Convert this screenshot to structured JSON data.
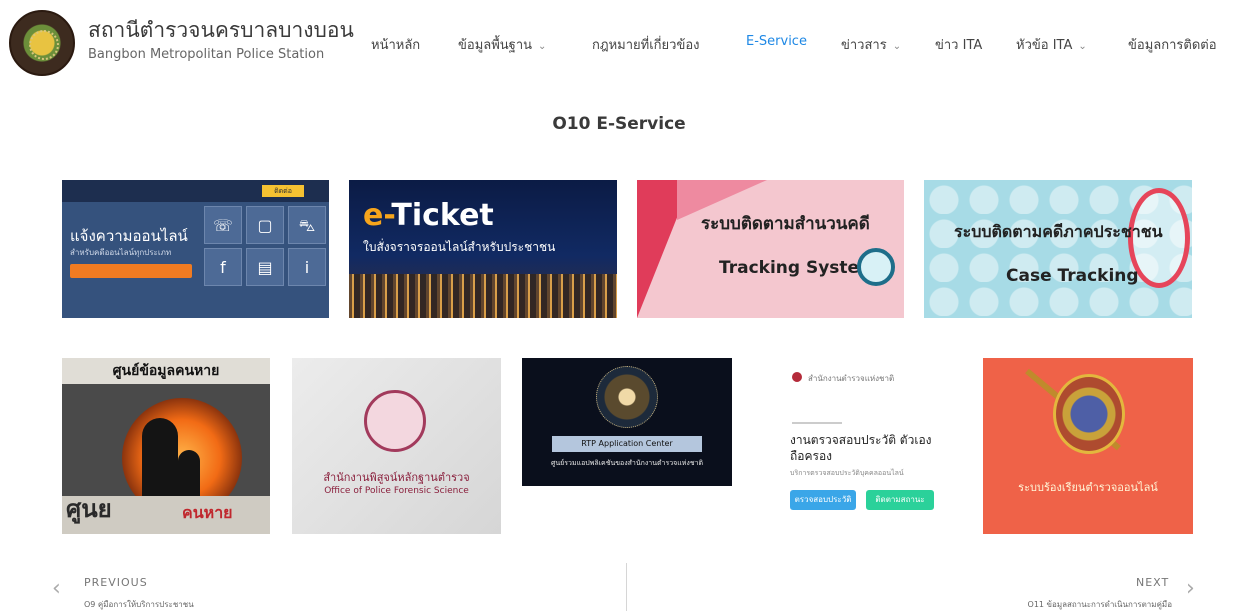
{
  "brand": {
    "title": "สถานีตำรวจนครบาลบางบอน",
    "subtitle": "Bangbon Metropolitan Police Station"
  },
  "nav": {
    "items": [
      {
        "label": "หน้าหลัก",
        "dropdown": false
      },
      {
        "label": "ข้อมูลพื้นฐาน",
        "dropdown": true
      },
      {
        "label": "กฎหมายที่เกี่ยวข้อง",
        "dropdown": false
      },
      {
        "label": "E-Service",
        "dropdown": false,
        "active": true
      },
      {
        "label": "ข่าวสาร",
        "dropdown": true
      },
      {
        "label": "ข่าว ITA",
        "dropdown": false
      },
      {
        "label": "หัวข้อ ITA",
        "dropdown": true
      },
      {
        "label": "ข้อมูลการติดต่อ",
        "dropdown": false
      }
    ],
    "caret": "⌄",
    "active_color": "#1e88e5"
  },
  "page": {
    "title": "O10 E-Service"
  },
  "cards": {
    "online_report": {
      "headline": "แจ้งความออนไลน์",
      "sub": "สำหรับคดีออนไลน์ทุกประเภท",
      "badge": "ติดต่อ",
      "icons": [
        "phone-icon",
        "chat-icon",
        "car-icon",
        "facebook-icon",
        "document-icon",
        "info-icon"
      ],
      "accent": "#f07b21"
    },
    "eticket": {
      "e": "e-",
      "word": "Ticket",
      "sub": "ใบสั่งจราจรออนไลน์สำหรับประชาชน"
    },
    "tracking": {
      "th": "ระบบติดตามสำนวนคดี",
      "en": "Tracking System"
    },
    "case_tracking": {
      "th": "ระบบติดตามคดีภาคประชาชน",
      "en": "Case Tracking"
    },
    "missing": {
      "header": "ศูนย์ข้อมูลคนหาย",
      "foot_a": "ศูนย",
      "foot_b": "คนหาย"
    },
    "forensic": {
      "th": "สำนักงานพิสูจน์หลักฐานตำรวจ",
      "en": "Office of Police Forensic Science"
    },
    "rtp": {
      "caption": "RTP Application Center",
      "sub": "ศูนย์รวมแอปพลิเคชันของสำนักงานตำรวจแห่งชาติ"
    },
    "background_check": {
      "brand": "สำนักงานตำรวจแห่งชาติ",
      "title": "งานตรวจสอบประวัติ ตัวเอง ถือครอง",
      "sub": "บริการตรวจสอบประวัติบุคคลออนไลน์",
      "btn1": "ตรวจสอบประวัติ",
      "btn2": "ติดตามสถานะ"
    },
    "complaint": {
      "caption": "ระบบร้องเรียนตำรวจออนไลน์"
    }
  },
  "footer": {
    "prev_label": "PREVIOUS",
    "prev_title": "O9 คู่มือการให้บริการประชาชน",
    "next_label": "NEXT",
    "next_title": "O11 ข้อมูลสถานะการดำเนินการตามคู่มือ"
  }
}
